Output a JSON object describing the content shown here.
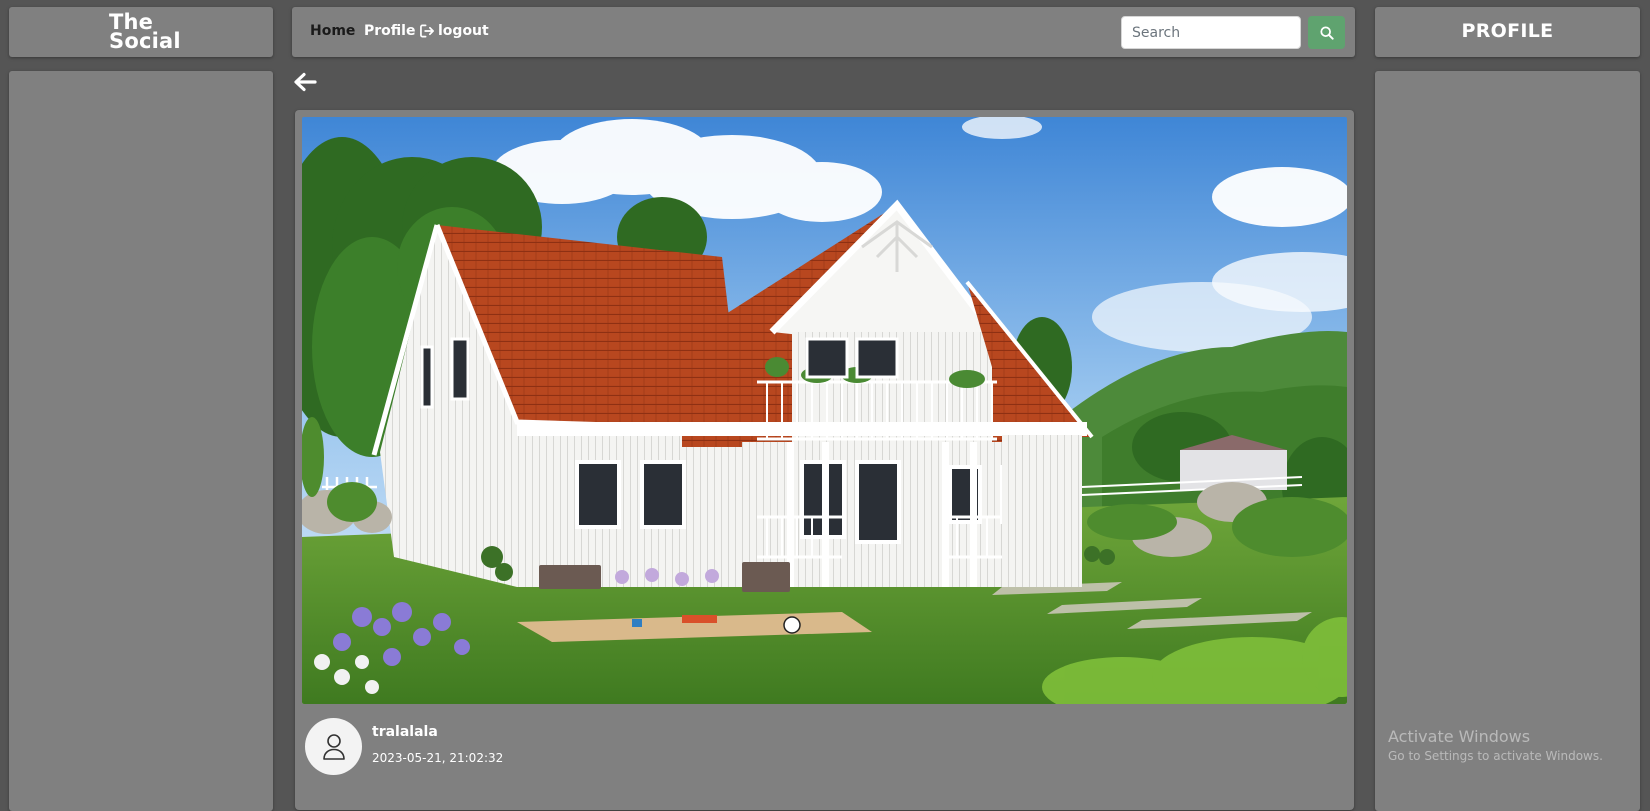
{
  "brand": {
    "line1": "The",
    "line2": "Social"
  },
  "nav": {
    "home": "Home",
    "profile": "Profile",
    "logout": "logout"
  },
  "search": {
    "placeholder": "Search",
    "value": ""
  },
  "right_panel": {
    "title": "PROFILE"
  },
  "post": {
    "author": "tralalala",
    "timestamp": "2023-05-21, 21:02:32",
    "image_subject": "white-house-red-roof"
  },
  "watermark": {
    "title": "Activate Windows",
    "subtitle": "Go to Settings to activate Windows."
  },
  "icons": {
    "back": "arrow-left-icon",
    "logout": "sign-out-icon",
    "search": "search-icon",
    "avatar": "user-icon"
  },
  "colors": {
    "background": "#555555",
    "panel": "#808080",
    "search_button": "#5fa36f",
    "home_link": "#1a1a1a"
  }
}
